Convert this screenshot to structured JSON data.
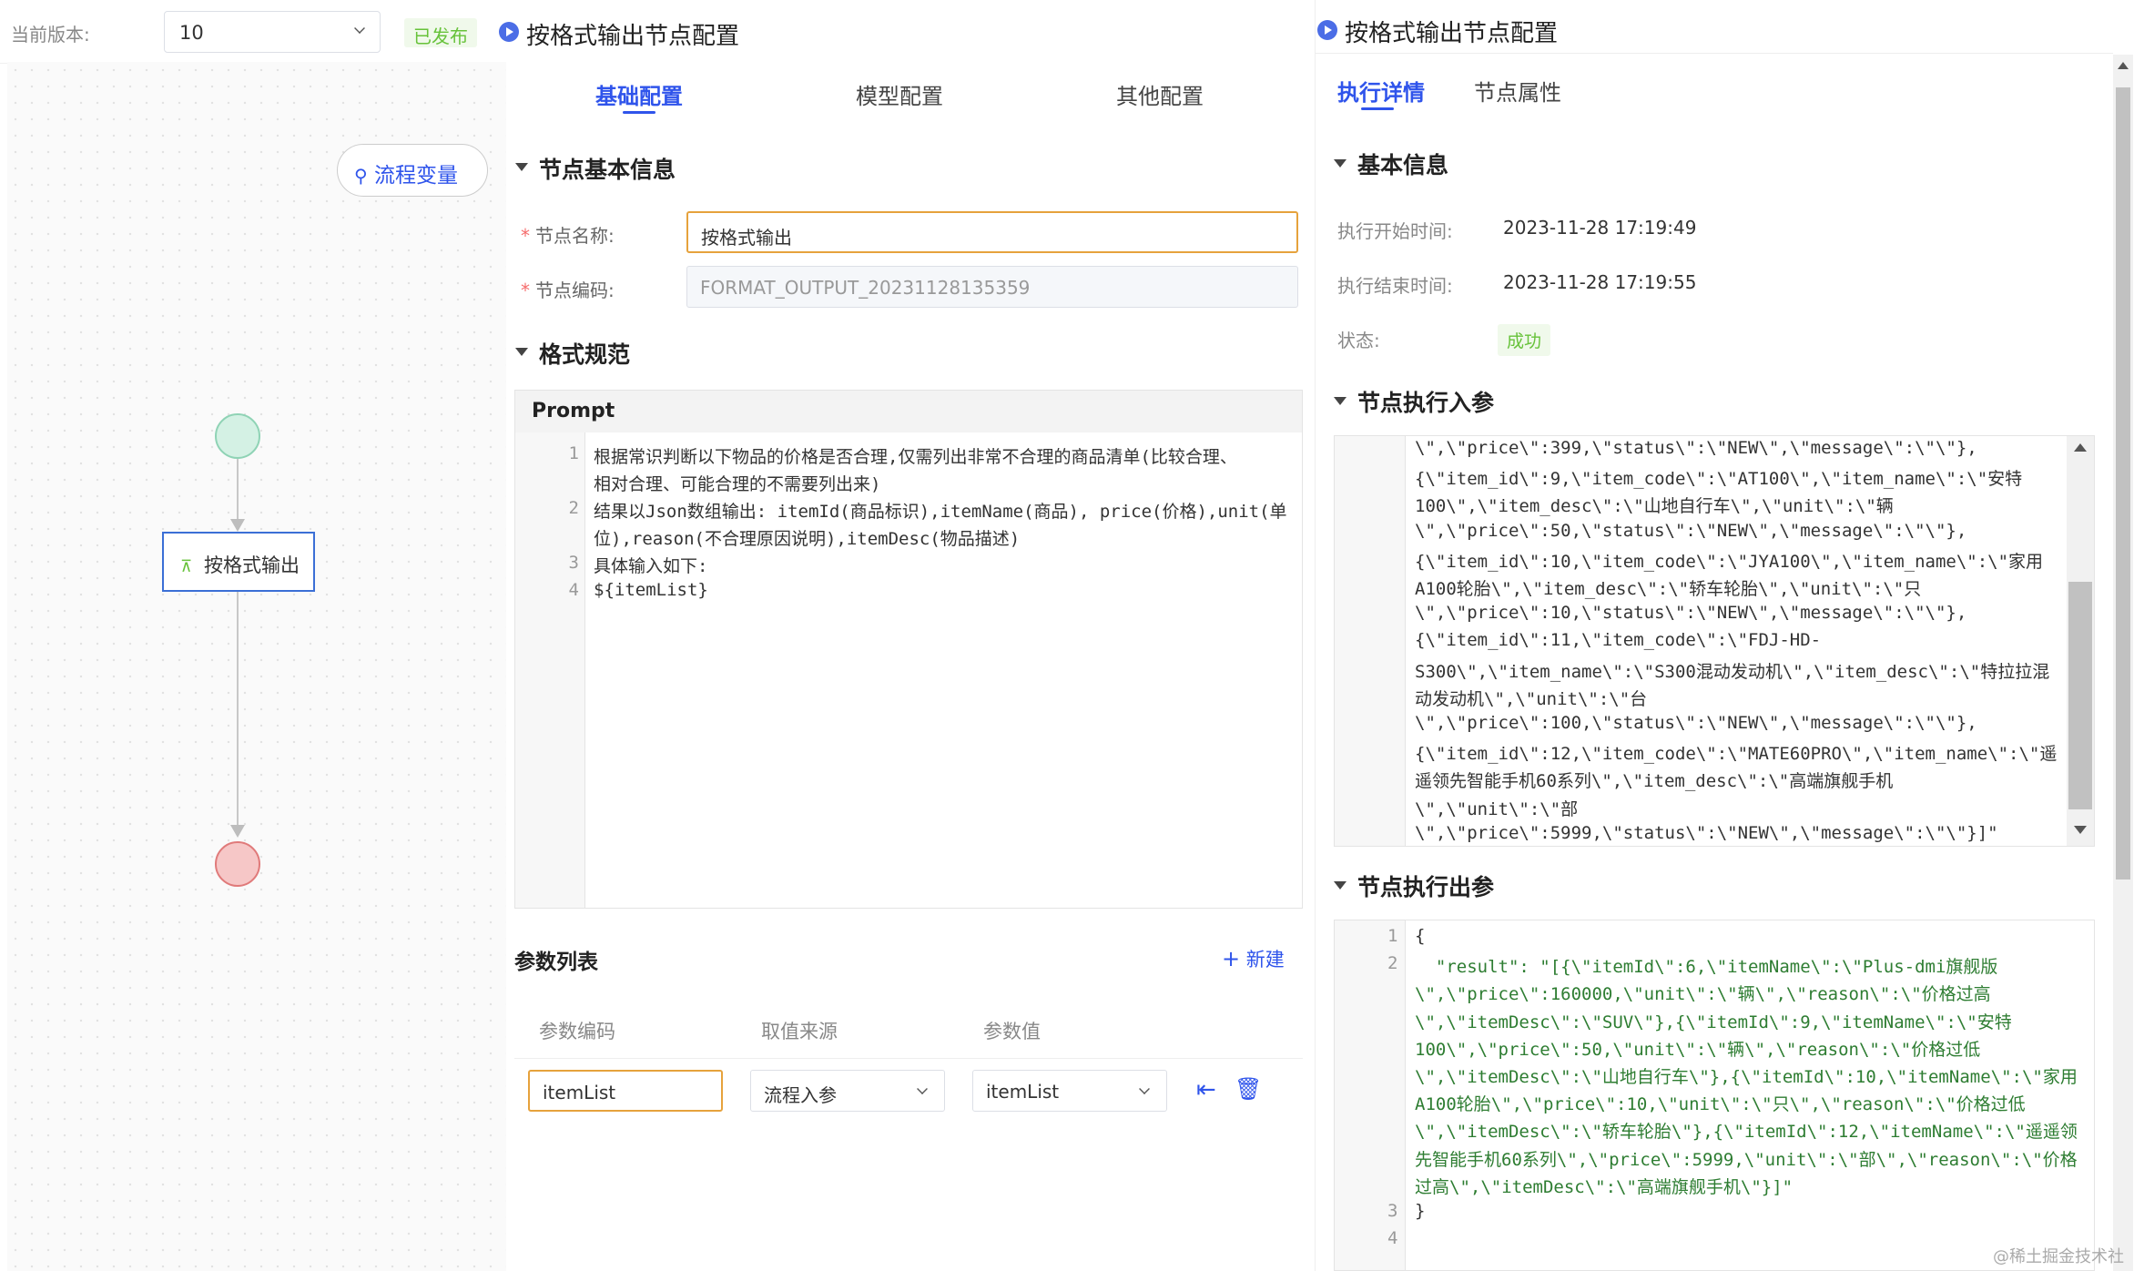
{
  "topbar": {
    "version_label": "当前版本:",
    "version_value": "10",
    "status_badge": "已发布"
  },
  "canvas": {
    "flow_var_button": "流程变量",
    "node_label": "按格式输出"
  },
  "config_panel": {
    "title": "按格式输出节点配置",
    "tabs": [
      "基础配置",
      "模型配置",
      "其他配置"
    ],
    "section_basic": "节点基本信息",
    "node_name_label": "节点名称:",
    "node_name_value": "按格式输出",
    "node_code_label": "节点编码:",
    "node_code_value": "FORMAT_OUTPUT_20231128135359",
    "section_format": "格式规范",
    "prompt_label": "Prompt",
    "prompt_lines": [
      {
        "num": "1",
        "text": "根据常识判断以下物品的价格是否合理,仅需列出非常不合理的商品清单(比较合理、"
      },
      {
        "num": "",
        "text": "相对合理、可能合理的不需要列出来)"
      },
      {
        "num": "2",
        "text": "结果以Json数组输出: itemId(商品标识),itemName(商品), price(价格),unit(单"
      },
      {
        "num": "",
        "text": "位),reason(不合理原因说明),itemDesc(物品描述)"
      },
      {
        "num": "3",
        "text": "具体输入如下:"
      },
      {
        "num": "4",
        "text": "${itemList}"
      }
    ],
    "params_title": "参数列表",
    "new_button": "新建",
    "param_headers": [
      "参数编码",
      "取值来源",
      "参数值"
    ],
    "param_row": {
      "code": "itemList",
      "source": "流程入参",
      "value": "itemList"
    }
  },
  "exec_panel": {
    "title": "按格式输出节点配置",
    "tabs": [
      "执行详情",
      "节点属性"
    ],
    "section_basic": "基本信息",
    "start_label": "执行开始时间:",
    "start_value": "2023-11-28 17:19:49",
    "end_label": "执行结束时间:",
    "end_value": "2023-11-28 17:19:55",
    "status_label": "状态:",
    "status_value": "成功",
    "section_input": "节点执行入参",
    "input_lines": [
      "\\\",\\\"price\\\":399,\\\"status\\\":\\\"NEW\\\",\\\"message\\\":\\\"\\\"},",
      "{\\\"item_id\\\":9,\\\"item_code\\\":\\\"AT100\\\",\\\"item_name\\\":\\\"安特",
      "100\\\",\\\"item_desc\\\":\\\"山地自行车\\\",\\\"unit\\\":\\\"辆",
      "\\\",\\\"price\\\":50,\\\"status\\\":\\\"NEW\\\",\\\"message\\\":\\\"\\\"},",
      "{\\\"item_id\\\":10,\\\"item_code\\\":\\\"JYA100\\\",\\\"item_name\\\":\\\"家用",
      "A100轮胎\\\",\\\"item_desc\\\":\\\"轿车轮胎\\\",\\\"unit\\\":\\\"只",
      "\\\",\\\"price\\\":10,\\\"status\\\":\\\"NEW\\\",\\\"message\\\":\\\"\\\"},",
      "{\\\"item_id\\\":11,\\\"item_code\\\":\\\"FDJ-HD-",
      "S300\\\",\\\"item_name\\\":\\\"S300混动发动机\\\",\\\"item_desc\\\":\\\"特拉拉混",
      "动发动机\\\",\\\"unit\\\":\\\"台",
      "\\\",\\\"price\\\":100,\\\"status\\\":\\\"NEW\\\",\\\"message\\\":\\\"\\\"},",
      "{\\\"item_id\\\":12,\\\"item_code\\\":\\\"MATE60PRO\\\",\\\"item_name\\\":\\\"遥",
      "遥领先智能手机60系列\\\",\\\"item_desc\\\":\\\"高端旗舰手机",
      "\\\",\\\"unit\\\":\\\"部",
      "\\\",\\\"price\\\":5999,\\\"status\\\":\\\"NEW\\\",\\\"message\\\":\\\"\\\"}]\""
    ],
    "section_output": "节点执行出参",
    "output_lines": [
      {
        "num": "1",
        "text": "{"
      },
      {
        "num": "2",
        "text": "  \"result\": \"[{\\\"itemId\\\":6,\\\"itemName\\\":\\\"Plus-dmi旗舰版"
      },
      {
        "num": "",
        "text": "\\\",\\\"price\\\":160000,\\\"unit\\\":\\\"辆\\\",\\\"reason\\\":\\\"价格过高"
      },
      {
        "num": "",
        "text": "\\\",\\\"itemDesc\\\":\\\"SUV\\\"},{\\\"itemId\\\":9,\\\"itemName\\\":\\\"安特"
      },
      {
        "num": "",
        "text": "100\\\",\\\"price\\\":50,\\\"unit\\\":\\\"辆\\\",\\\"reason\\\":\\\"价格过低"
      },
      {
        "num": "",
        "text": "\\\",\\\"itemDesc\\\":\\\"山地自行车\\\"},{\\\"itemId\\\":10,\\\"itemName\\\":\\\"家用"
      },
      {
        "num": "",
        "text": "A100轮胎\\\",\\\"price\\\":10,\\\"unit\\\":\\\"只\\\",\\\"reason\\\":\\\"价格过低"
      },
      {
        "num": "",
        "text": "\\\",\\\"itemDesc\\\":\\\"轿车轮胎\\\"},{\\\"itemId\\\":12,\\\"itemName\\\":\\\"遥遥领"
      },
      {
        "num": "",
        "text": "先智能手机60系列\\\",\\\"price\\\":5999,\\\"unit\\\":\\\"部\\\",\\\"reason\\\":\\\"价格"
      },
      {
        "num": "",
        "text": "过高\\\",\\\"itemDesc\\\":\\\"高端旗舰手机\\\"}]\""
      },
      {
        "num": "3",
        "text": "}"
      },
      {
        "num": "4",
        "text": ""
      }
    ]
  },
  "watermark": "@稀土掘金技术社区",
  "colors": {
    "accent": "#2f54eb",
    "success": "#67c23a",
    "focus_border": "#e6a23c",
    "required": "#f56c6c"
  }
}
